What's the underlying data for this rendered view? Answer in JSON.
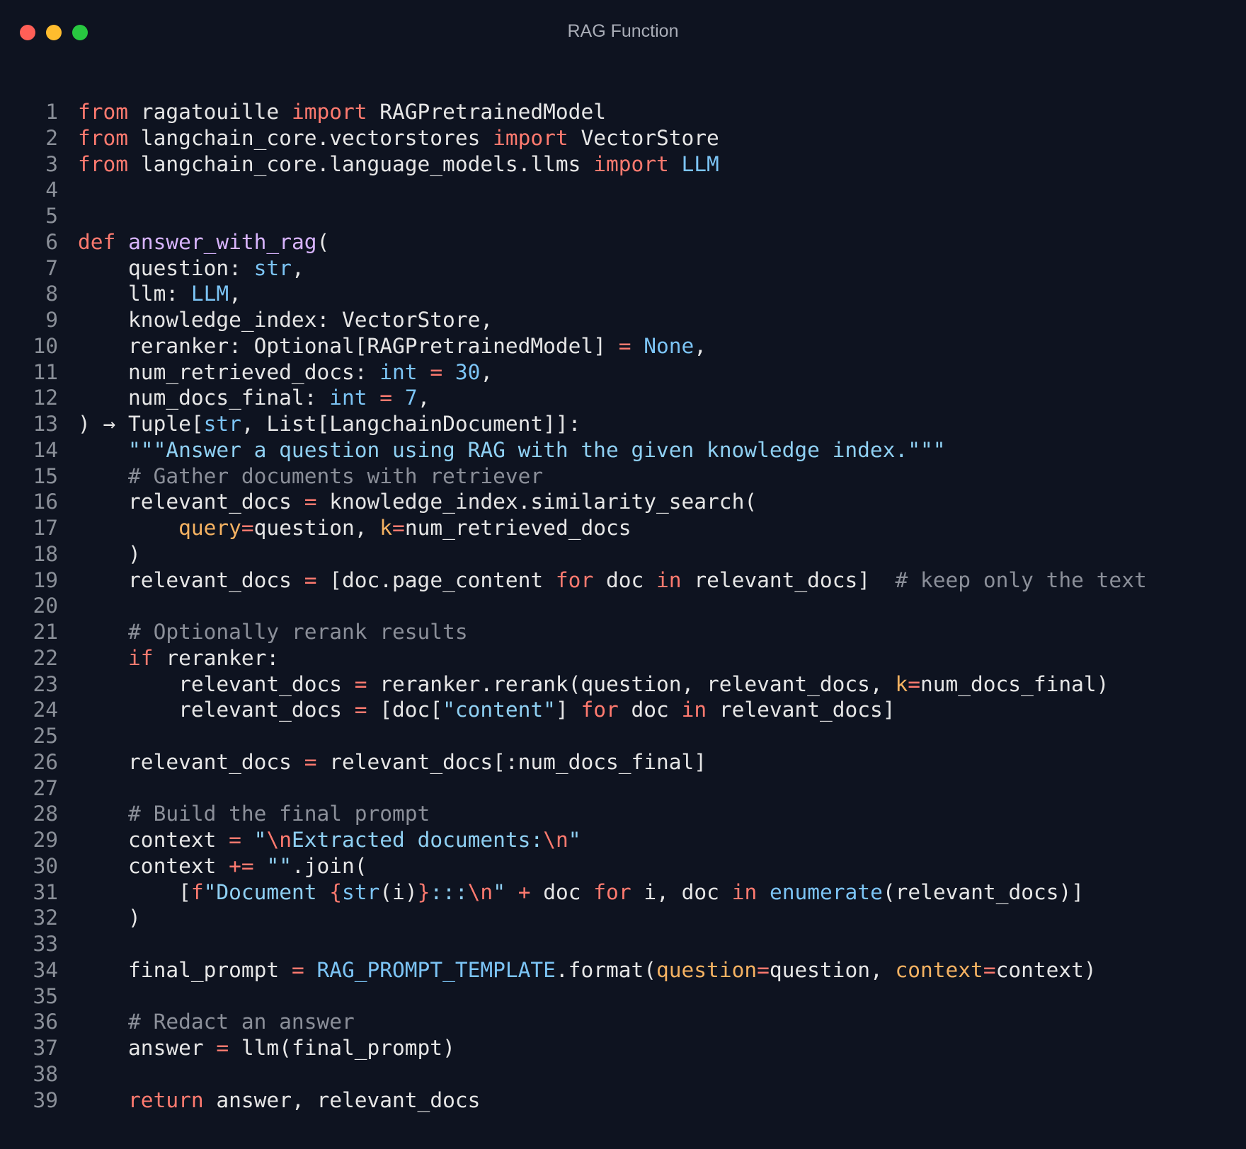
{
  "window": {
    "title": "RAG Function",
    "controls": [
      {
        "name": "close",
        "color": "#ff5f57"
      },
      {
        "name": "minimize",
        "color": "#febc2e"
      },
      {
        "name": "maximize",
        "color": "#28c840"
      }
    ]
  },
  "editor": {
    "lines": [
      {
        "n": "1",
        "tokens": [
          [
            "kw",
            "from"
          ],
          [
            "plain",
            " ragatouille "
          ],
          [
            "kw",
            "import"
          ],
          [
            "plain",
            " RAGPretrainedModel"
          ]
        ]
      },
      {
        "n": "2",
        "tokens": [
          [
            "kw",
            "from"
          ],
          [
            "plain",
            " langchain_core.vectorstores "
          ],
          [
            "kw",
            "import"
          ],
          [
            "plain",
            " VectorStore"
          ]
        ]
      },
      {
        "n": "3",
        "tokens": [
          [
            "kw",
            "from"
          ],
          [
            "plain",
            " langchain_core.language_models.llms "
          ],
          [
            "kw",
            "import"
          ],
          [
            "plain",
            " "
          ],
          [
            "type",
            "LLM"
          ]
        ]
      },
      {
        "n": "4",
        "tokens": []
      },
      {
        "n": "5",
        "tokens": []
      },
      {
        "n": "6",
        "tokens": [
          [
            "kw",
            "def"
          ],
          [
            "plain",
            " "
          ],
          [
            "fn",
            "answer_with_rag"
          ],
          [
            "plain",
            "("
          ]
        ]
      },
      {
        "n": "7",
        "tokens": [
          [
            "plain",
            "    question: "
          ],
          [
            "type",
            "str"
          ],
          [
            "plain",
            ","
          ]
        ]
      },
      {
        "n": "8",
        "tokens": [
          [
            "plain",
            "    llm: "
          ],
          [
            "type",
            "LLM"
          ],
          [
            "plain",
            ","
          ]
        ]
      },
      {
        "n": "9",
        "tokens": [
          [
            "plain",
            "    knowledge_index: VectorStore,"
          ]
        ]
      },
      {
        "n": "10",
        "tokens": [
          [
            "plain",
            "    reranker: Optional[RAGPretrainedModel] "
          ],
          [
            "op",
            "="
          ],
          [
            "plain",
            " "
          ],
          [
            "type",
            "None"
          ],
          [
            "plain",
            ","
          ]
        ]
      },
      {
        "n": "11",
        "tokens": [
          [
            "plain",
            "    num_retrieved_docs: "
          ],
          [
            "type",
            "int"
          ],
          [
            "plain",
            " "
          ],
          [
            "op",
            "="
          ],
          [
            "plain",
            " "
          ],
          [
            "num",
            "30"
          ],
          [
            "plain",
            ","
          ]
        ]
      },
      {
        "n": "12",
        "tokens": [
          [
            "plain",
            "    num_docs_final: "
          ],
          [
            "type",
            "int"
          ],
          [
            "plain",
            " "
          ],
          [
            "op",
            "="
          ],
          [
            "plain",
            " "
          ],
          [
            "num",
            "7"
          ],
          [
            "plain",
            ","
          ]
        ]
      },
      {
        "n": "13",
        "tokens": [
          [
            "plain",
            ") → Tuple["
          ],
          [
            "type",
            "str"
          ],
          [
            "plain",
            ", List[LangchainDocument]]:"
          ]
        ]
      },
      {
        "n": "14",
        "tokens": [
          [
            "plain",
            "    "
          ],
          [
            "str",
            "\"\"\"Answer a question using RAG with the given knowledge index.\"\"\""
          ]
        ]
      },
      {
        "n": "15",
        "tokens": [
          [
            "plain",
            "    "
          ],
          [
            "comment",
            "# Gather documents with retriever"
          ]
        ]
      },
      {
        "n": "16",
        "tokens": [
          [
            "plain",
            "    relevant_docs "
          ],
          [
            "op",
            "="
          ],
          [
            "plain",
            " knowledge_index.similarity_search("
          ]
        ]
      },
      {
        "n": "17",
        "tokens": [
          [
            "plain",
            "        "
          ],
          [
            "param",
            "query"
          ],
          [
            "op",
            "="
          ],
          [
            "plain",
            "question, "
          ],
          [
            "param",
            "k"
          ],
          [
            "op",
            "="
          ],
          [
            "plain",
            "num_retrieved_docs"
          ]
        ]
      },
      {
        "n": "18",
        "tokens": [
          [
            "plain",
            "    )"
          ]
        ]
      },
      {
        "n": "19",
        "tokens": [
          [
            "plain",
            "    relevant_docs "
          ],
          [
            "op",
            "="
          ],
          [
            "plain",
            " [doc.page_content "
          ],
          [
            "kw",
            "for"
          ],
          [
            "plain",
            " doc "
          ],
          [
            "kw",
            "in"
          ],
          [
            "plain",
            " relevant_docs]  "
          ],
          [
            "comment",
            "# keep only the text"
          ]
        ]
      },
      {
        "n": "20",
        "tokens": []
      },
      {
        "n": "21",
        "tokens": [
          [
            "plain",
            "    "
          ],
          [
            "comment",
            "# Optionally rerank results"
          ]
        ]
      },
      {
        "n": "22",
        "tokens": [
          [
            "plain",
            "    "
          ],
          [
            "kw",
            "if"
          ],
          [
            "plain",
            " reranker:"
          ]
        ]
      },
      {
        "n": "23",
        "tokens": [
          [
            "plain",
            "        relevant_docs "
          ],
          [
            "op",
            "="
          ],
          [
            "plain",
            " reranker.rerank(question, relevant_docs, "
          ],
          [
            "param",
            "k"
          ],
          [
            "op",
            "="
          ],
          [
            "plain",
            "num_docs_final)"
          ]
        ]
      },
      {
        "n": "24",
        "tokens": [
          [
            "plain",
            "        relevant_docs "
          ],
          [
            "op",
            "="
          ],
          [
            "plain",
            " [doc["
          ],
          [
            "str",
            "\"content\""
          ],
          [
            "plain",
            "] "
          ],
          [
            "kw",
            "for"
          ],
          [
            "plain",
            " doc "
          ],
          [
            "kw",
            "in"
          ],
          [
            "plain",
            " relevant_docs]"
          ]
        ]
      },
      {
        "n": "25",
        "tokens": []
      },
      {
        "n": "26",
        "tokens": [
          [
            "plain",
            "    relevant_docs "
          ],
          [
            "op",
            "="
          ],
          [
            "plain",
            " relevant_docs[:num_docs_final]"
          ]
        ]
      },
      {
        "n": "27",
        "tokens": []
      },
      {
        "n": "28",
        "tokens": [
          [
            "plain",
            "    "
          ],
          [
            "comment",
            "# Build the final prompt"
          ]
        ]
      },
      {
        "n": "29",
        "tokens": [
          [
            "plain",
            "    context "
          ],
          [
            "op",
            "="
          ],
          [
            "plain",
            " "
          ],
          [
            "str",
            "\""
          ],
          [
            "esc",
            "\\n"
          ],
          [
            "str",
            "Extracted documents:"
          ],
          [
            "esc",
            "\\n"
          ],
          [
            "str",
            "\""
          ]
        ]
      },
      {
        "n": "30",
        "tokens": [
          [
            "plain",
            "    context "
          ],
          [
            "op",
            "+="
          ],
          [
            "plain",
            " "
          ],
          [
            "str",
            "\"\""
          ],
          [
            "plain",
            ".join("
          ]
        ]
      },
      {
        "n": "31",
        "tokens": [
          [
            "plain",
            "        ["
          ],
          [
            "esc",
            "f"
          ],
          [
            "str",
            "\"Document "
          ],
          [
            "esc",
            "{"
          ],
          [
            "type",
            "str"
          ],
          [
            "plain",
            "(i)"
          ],
          [
            "esc",
            "}"
          ],
          [
            "str",
            ":::"
          ],
          [
            "esc",
            "\\n"
          ],
          [
            "str",
            "\""
          ],
          [
            "plain",
            " "
          ],
          [
            "op",
            "+"
          ],
          [
            "plain",
            " doc "
          ],
          [
            "kw",
            "for"
          ],
          [
            "plain",
            " i, doc "
          ],
          [
            "kw",
            "in"
          ],
          [
            "plain",
            " "
          ],
          [
            "type",
            "enumerate"
          ],
          [
            "plain",
            "(relevant_docs)]"
          ]
        ]
      },
      {
        "n": "32",
        "tokens": [
          [
            "plain",
            "    )"
          ]
        ]
      },
      {
        "n": "33",
        "tokens": []
      },
      {
        "n": "34",
        "tokens": [
          [
            "plain",
            "    final_prompt "
          ],
          [
            "op",
            "="
          ],
          [
            "plain",
            " "
          ],
          [
            "type",
            "RAG_PROMPT_TEMPLATE"
          ],
          [
            "plain",
            ".format("
          ],
          [
            "param",
            "question"
          ],
          [
            "op",
            "="
          ],
          [
            "plain",
            "question, "
          ],
          [
            "param",
            "context"
          ],
          [
            "op",
            "="
          ],
          [
            "plain",
            "context)"
          ]
        ]
      },
      {
        "n": "35",
        "tokens": []
      },
      {
        "n": "36",
        "tokens": [
          [
            "plain",
            "    "
          ],
          [
            "comment",
            "# Redact an answer"
          ]
        ]
      },
      {
        "n": "37",
        "tokens": [
          [
            "plain",
            "    answer "
          ],
          [
            "op",
            "="
          ],
          [
            "plain",
            " llm(final_prompt)"
          ]
        ]
      },
      {
        "n": "38",
        "tokens": []
      },
      {
        "n": "39",
        "tokens": [
          [
            "plain",
            "    "
          ],
          [
            "kw",
            "return"
          ],
          [
            "plain",
            " answer, relevant_docs"
          ]
        ]
      }
    ]
  }
}
